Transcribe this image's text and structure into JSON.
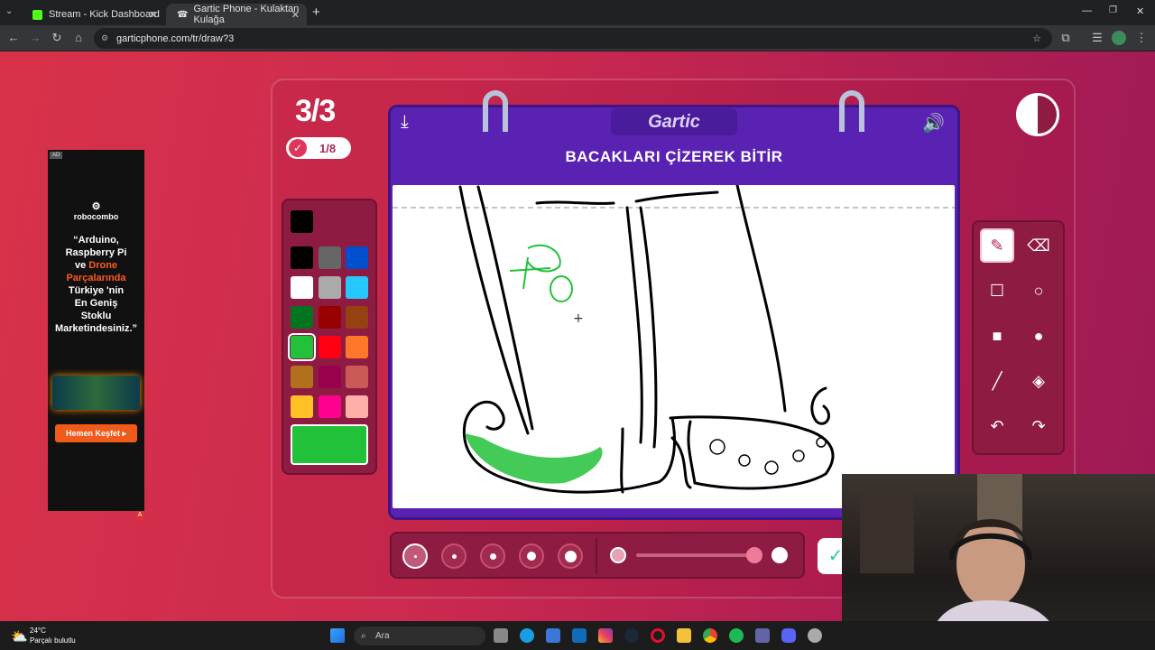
{
  "browser": {
    "tabs": [
      {
        "title": "Stream - Kick Dashboard"
      },
      {
        "title": "Gartic Phone - Kulaktan Kulağa"
      }
    ],
    "url": "garticphone.com/tr/draw?3"
  },
  "game": {
    "round": "3/3",
    "done_count": "1/8",
    "logo": "Gartic",
    "instruction": "BACAKLARI ÇİZEREK BİTİR",
    "selected_color": "#22c13a",
    "palette": [
      "#000000",
      "#666666",
      "#0050ce",
      "#ffffff",
      "#aaaaaa",
      "#26c9ff",
      "#017420",
      "#990000",
      "#964112",
      "#22c13a",
      "#ff0013",
      "#ff7829",
      "#b0701c",
      "#99004e",
      "#cb5a57",
      "#ffc126",
      "#ff008f",
      "#feafa8"
    ],
    "selected_tool": "pencil-tool",
    "selected_brush_size": 1
  },
  "ad": {
    "tag": "AD",
    "brand": "robocombo",
    "line1": "“Arduino,",
    "line2": "Raspberry Pi",
    "line3_a": "ve ",
    "line3_b": "Drone",
    "line4": "Parçalarında",
    "line5": "Türkiye 'nin",
    "line6": "En Geniş",
    "line7": "Stoklu",
    "line8": "Marketindesiniz.”",
    "cta": "Hemen Keşfet ▸"
  },
  "taskbar": {
    "weather_temp": "24°C",
    "weather_desc": "Parçalı bulutlu",
    "search_placeholder": "Ara"
  }
}
